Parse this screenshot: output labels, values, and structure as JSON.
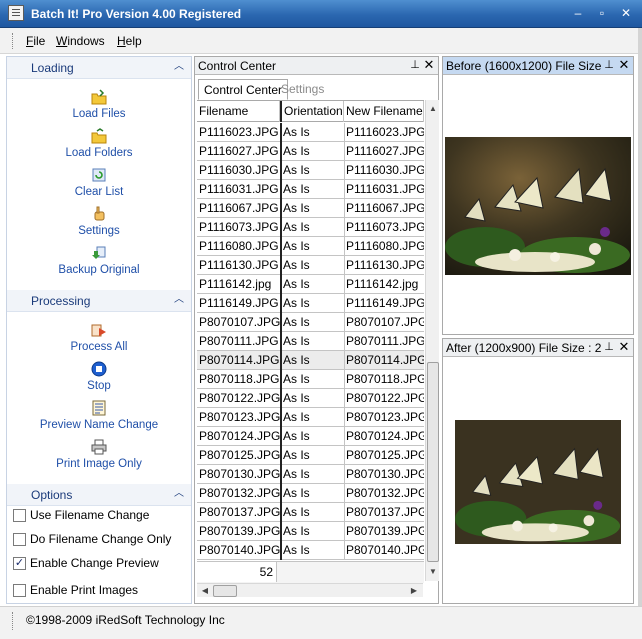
{
  "window": {
    "title": "Batch It! Pro  Version 4.00 Registered",
    "min": "‒",
    "max": "▫",
    "close": "✕"
  },
  "menu": [
    "File",
    "Windows",
    "Help"
  ],
  "sidebar": {
    "sections": [
      {
        "title": "Loading",
        "items": [
          "Load Files",
          "Load Folders",
          "Clear List",
          "Settings",
          "Backup Original"
        ]
      },
      {
        "title": "Processing",
        "items": [
          "Process All",
          "Stop",
          "Preview Name Change",
          "Print Image Only"
        ]
      },
      {
        "title": "Options",
        "options": [
          {
            "label": "Use Filename Change",
            "checked": false
          },
          {
            "label": "Do Filename Change Only",
            "checked": false
          },
          {
            "label": "Enable Change Preview",
            "checked": true
          },
          {
            "label": "Enable Print Images",
            "checked": false
          }
        ]
      }
    ]
  },
  "control_center": {
    "title": "Control Center",
    "tabs": [
      "Control Center",
      "Settings"
    ],
    "columns": [
      "Filename",
      "Orientation",
      "New Filename"
    ],
    "rows": [
      [
        "P1116023.JPG",
        "As Is",
        "P1116023.JPG"
      ],
      [
        "P1116027.JPG",
        "As Is",
        "P1116027.JPG"
      ],
      [
        "P1116030.JPG",
        "As Is",
        "P1116030.JPG"
      ],
      [
        "P1116031.JPG",
        "As Is",
        "P1116031.JPG"
      ],
      [
        "P1116067.JPG",
        "As Is",
        "P1116067.JPG"
      ],
      [
        "P1116073.JPG",
        "As Is",
        "P1116073.JPG"
      ],
      [
        "P1116080.JPG",
        "As Is",
        "P1116080.JPG"
      ],
      [
        "P1116130.JPG",
        "As Is",
        "P1116130.JPG"
      ],
      [
        "P1116142.jpg",
        "As Is",
        "P1116142.jpg"
      ],
      [
        "P1116149.JPG",
        "As Is",
        "P1116149.JPG"
      ],
      [
        "P8070107.JPG",
        "As Is",
        "P8070107.JPG"
      ],
      [
        "P8070111.JPG",
        "As Is",
        "P8070111.JPG"
      ],
      [
        "P8070114.JPG",
        "As Is",
        "P8070114.JPG"
      ],
      [
        "P8070118.JPG",
        "As Is",
        "P8070118.JPG"
      ],
      [
        "P8070122.JPG",
        "As Is",
        "P8070122.JPG"
      ],
      [
        "P8070123.JPG",
        "As Is",
        "P8070123.JPG"
      ],
      [
        "P8070124.JPG",
        "As Is",
        "P8070124.JPG"
      ],
      [
        "P8070125.JPG",
        "As Is",
        "P8070125.JPG"
      ],
      [
        "P8070130.JPG",
        "As Is",
        "P8070130.JPG"
      ],
      [
        "P8070132.JPG",
        "As Is",
        "P8070132.JPG"
      ],
      [
        "P8070137.JPG",
        "As Is",
        "P8070137.JPG"
      ],
      [
        "P8070139.JPG",
        "As Is",
        "P8070139.JPG"
      ],
      [
        "P8070140.JPG",
        "As Is",
        "P8070140.JPG"
      ]
    ],
    "highlighted_row": 12,
    "count": "52"
  },
  "before_panel": {
    "title": "Before (1600x1200) File Size ..."
  },
  "after_panel": {
    "title": "After (1200x900) File Size : 2..."
  },
  "status": {
    "text": "©1998-2009 iRedSoft Technology Inc"
  }
}
